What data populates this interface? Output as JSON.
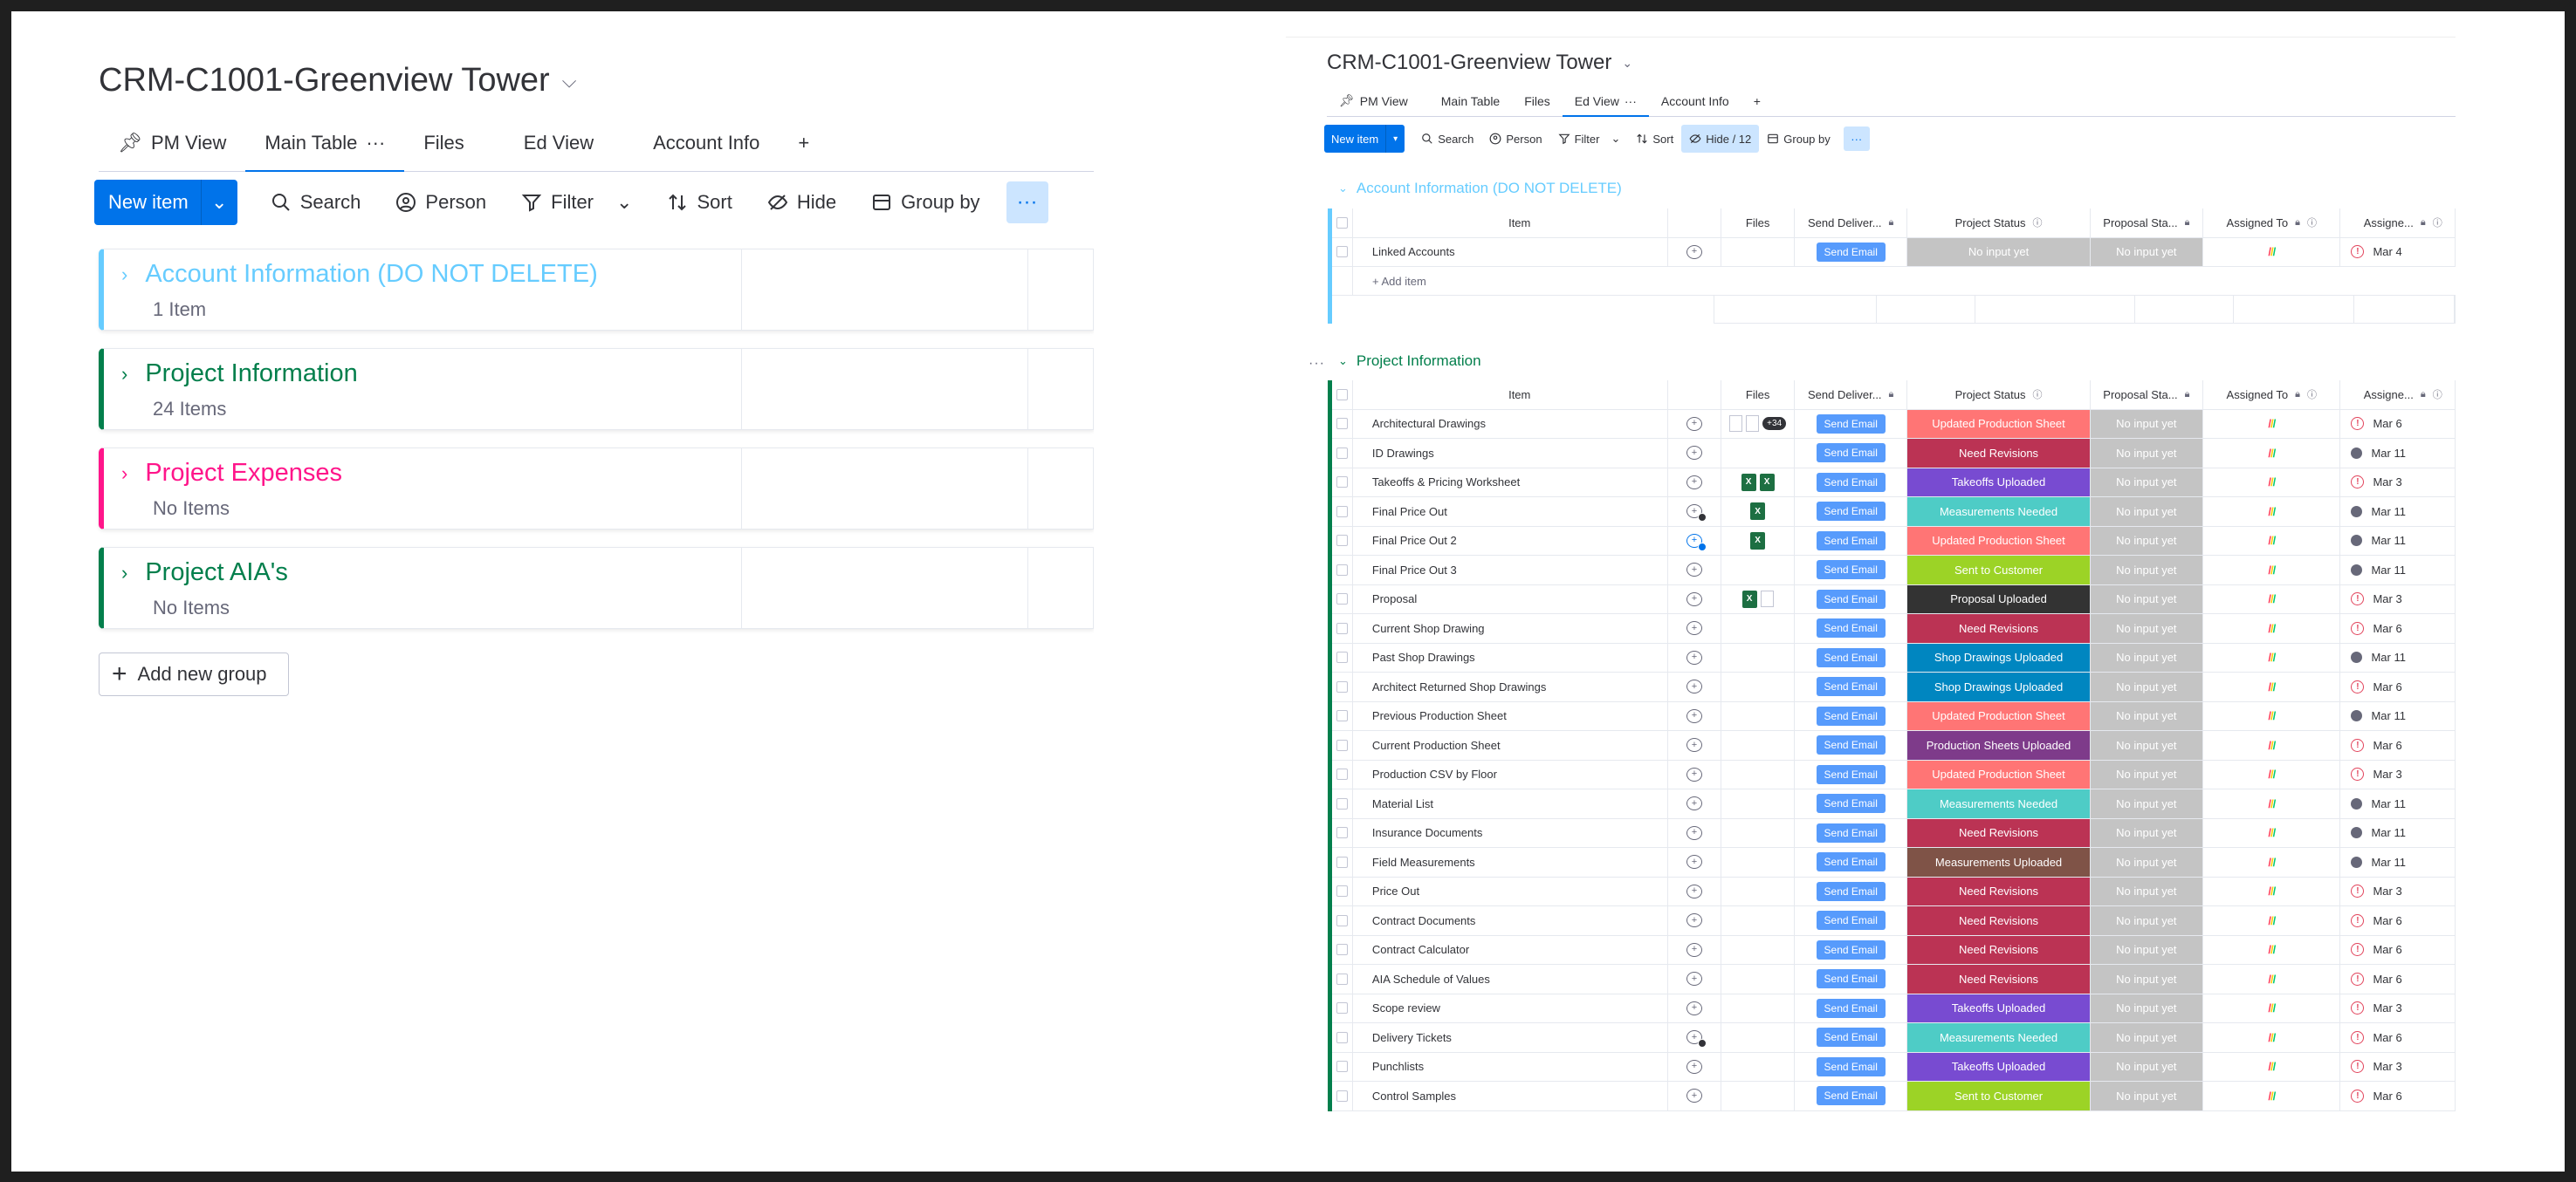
{
  "left": {
    "board_title": "CRM-C1001-Greenview Tower",
    "tabs": [
      {
        "label": "PM View",
        "icon": "pin-icon"
      },
      {
        "label": "Main Table",
        "active": true
      },
      {
        "label": "Files"
      },
      {
        "label": "Ed View"
      },
      {
        "label": "Account Info"
      },
      {
        "label": "+"
      }
    ],
    "toolbar": {
      "new_item": "New item",
      "search": "Search",
      "person": "Person",
      "filter": "Filter",
      "sort": "Sort",
      "hide": "Hide",
      "group_by": "Group by",
      "more": "···"
    },
    "groups": [
      {
        "name": "Account Information (DO NOT DELETE)",
        "count": "1 Item",
        "color": "#66ccff"
      },
      {
        "name": "Project Information",
        "count": "24 Items",
        "color": "#037f4c"
      },
      {
        "name": "Project Expenses",
        "count": "No Items",
        "color": "#ff158a"
      },
      {
        "name": "Project AIA's",
        "count": "No Items",
        "color": "#037f4c"
      }
    ],
    "add_group": "Add new group"
  },
  "right": {
    "board_title": "CRM-C1001-Greenview Tower",
    "tabs": [
      {
        "label": "PM View"
      },
      {
        "label": "Main Table"
      },
      {
        "label": "Files"
      },
      {
        "label": "Ed View",
        "active": true
      },
      {
        "label": "Account Info"
      },
      {
        "label": "+"
      }
    ],
    "toolbar": {
      "new_item": "New item",
      "search": "Search",
      "person": "Person",
      "filter": "Filter",
      "sort": "Sort",
      "hide": "Hide / 12",
      "group_by": "Group by",
      "more": "···"
    },
    "columns": {
      "item": "Item",
      "files": "Files",
      "send": "Send Deliver...",
      "status": "Project Status",
      "proposal": "Proposal Sta...",
      "assigned": "Assigned To",
      "assignee": "Assigne..."
    },
    "account_group": {
      "title": "Account Information (DO NOT DELETE)",
      "color": "#66ccff",
      "rows": [
        {
          "item": "Linked Accounts",
          "send": "Send Email",
          "status": "No input yet",
          "status_color": "#c4c4c4",
          "proposal": "No input yet",
          "date": "Mar 4",
          "icon": "alert"
        }
      ],
      "add_item": "+ Add item"
    },
    "project_group": {
      "title": "Project Information",
      "color": "#037f4c",
      "rows": [
        {
          "item": "Architectural Drawings",
          "files": "docs+34",
          "extra_files": "+34",
          "status": "Updated Production Sheet",
          "status_color": "#ff7575",
          "date": "Mar 6",
          "icon": "alert"
        },
        {
          "item": "ID Drawings",
          "files": "",
          "status": "Need Revisions",
          "status_color": "#bb3354",
          "date": "Mar 11",
          "icon": "dot"
        },
        {
          "item": "Takeoffs & Pricing Worksheet",
          "files": "xx",
          "status": "Takeoffs Uploaded",
          "status_color": "#784bd1",
          "date": "Mar 3",
          "icon": "alert"
        },
        {
          "item": "Final Price Out",
          "files": "x",
          "upd": "badge",
          "status": "Measurements Needed",
          "status_color": "#4eccc6",
          "date": "Mar 11",
          "icon": "dot"
        },
        {
          "item": "Final Price Out 2",
          "files": "x",
          "upd": "blue",
          "status": "Updated Production Sheet",
          "status_color": "#ff7575",
          "date": "Mar 11",
          "icon": "dot"
        },
        {
          "item": "Final Price Out 3",
          "files": "",
          "status": "Sent to Customer",
          "status_color": "#9cd326",
          "date": "Mar 11",
          "icon": "dot"
        },
        {
          "item": "Proposal",
          "files": "xd",
          "status": "Proposal Uploaded",
          "status_color": "#333333",
          "date": "Mar 3",
          "icon": "alert"
        },
        {
          "item": "Current Shop Drawing",
          "files": "",
          "status": "Need Revisions",
          "status_color": "#bb3354",
          "date": "Mar 6",
          "icon": "alert"
        },
        {
          "item": "Past Shop Drawings",
          "files": "",
          "status": "Shop Drawings Uploaded",
          "status_color": "#0086c0",
          "date": "Mar 11",
          "icon": "dot"
        },
        {
          "item": "Architect Returned Shop Drawings",
          "files": "",
          "status": "Shop Drawings Uploaded",
          "status_color": "#0086c0",
          "date": "Mar 6",
          "icon": "alert"
        },
        {
          "item": "Previous Production Sheet",
          "files": "",
          "status": "Updated Production Sheet",
          "status_color": "#ff7575",
          "date": "Mar 11",
          "icon": "dot"
        },
        {
          "item": "Current Production Sheet",
          "files": "",
          "status": "Production Sheets Uploaded",
          "status_color": "#7e3b8a",
          "date": "Mar 6",
          "icon": "alert"
        },
        {
          "item": "Production CSV by Floor",
          "files": "",
          "status": "Updated Production Sheet",
          "status_color": "#ff7575",
          "date": "Mar 3",
          "icon": "alert"
        },
        {
          "item": "Material List",
          "files": "",
          "status": "Measurements Needed",
          "status_color": "#4eccc6",
          "date": "Mar 11",
          "icon": "dot"
        },
        {
          "item": "Insurance Documents",
          "files": "",
          "status": "Need Revisions",
          "status_color": "#bb3354",
          "date": "Mar 11",
          "icon": "dot"
        },
        {
          "item": "Field Measurements",
          "files": "",
          "status": "Measurements Uploaded",
          "status_color": "#7f5347",
          "date": "Mar 11",
          "icon": "dot"
        },
        {
          "item": "Price Out",
          "files": "",
          "status": "Need Revisions",
          "status_color": "#bb3354",
          "date": "Mar 3",
          "icon": "alert"
        },
        {
          "item": "Contract Documents",
          "files": "",
          "status": "Need Revisions",
          "status_color": "#bb3354",
          "date": "Mar 6",
          "icon": "alert"
        },
        {
          "item": "Contract Calculator",
          "files": "",
          "status": "Need Revisions",
          "status_color": "#bb3354",
          "date": "Mar 6",
          "icon": "alert"
        },
        {
          "item": "AIA Schedule of Values",
          "files": "",
          "status": "Need Revisions",
          "status_color": "#bb3354",
          "date": "Mar 6",
          "icon": "alert"
        },
        {
          "item": "Scope review",
          "files": "",
          "status": "Takeoffs Uploaded",
          "status_color": "#784bd1",
          "date": "Mar 3",
          "icon": "alert"
        },
        {
          "item": "Delivery Tickets",
          "files": "",
          "upd": "badge",
          "status": "Measurements Needed",
          "status_color": "#4eccc6",
          "date": "Mar 6",
          "icon": "alert"
        },
        {
          "item": "Punchlists",
          "files": "",
          "status": "Takeoffs Uploaded",
          "status_color": "#784bd1",
          "date": "Mar 3",
          "icon": "alert"
        },
        {
          "item": "Control Samples",
          "files": "",
          "status": "Sent to Customer",
          "status_color": "#9cd326",
          "date": "Mar 6",
          "icon": "alert"
        }
      ],
      "send_label": "Send Email",
      "proposal_label": "No input yet"
    }
  }
}
